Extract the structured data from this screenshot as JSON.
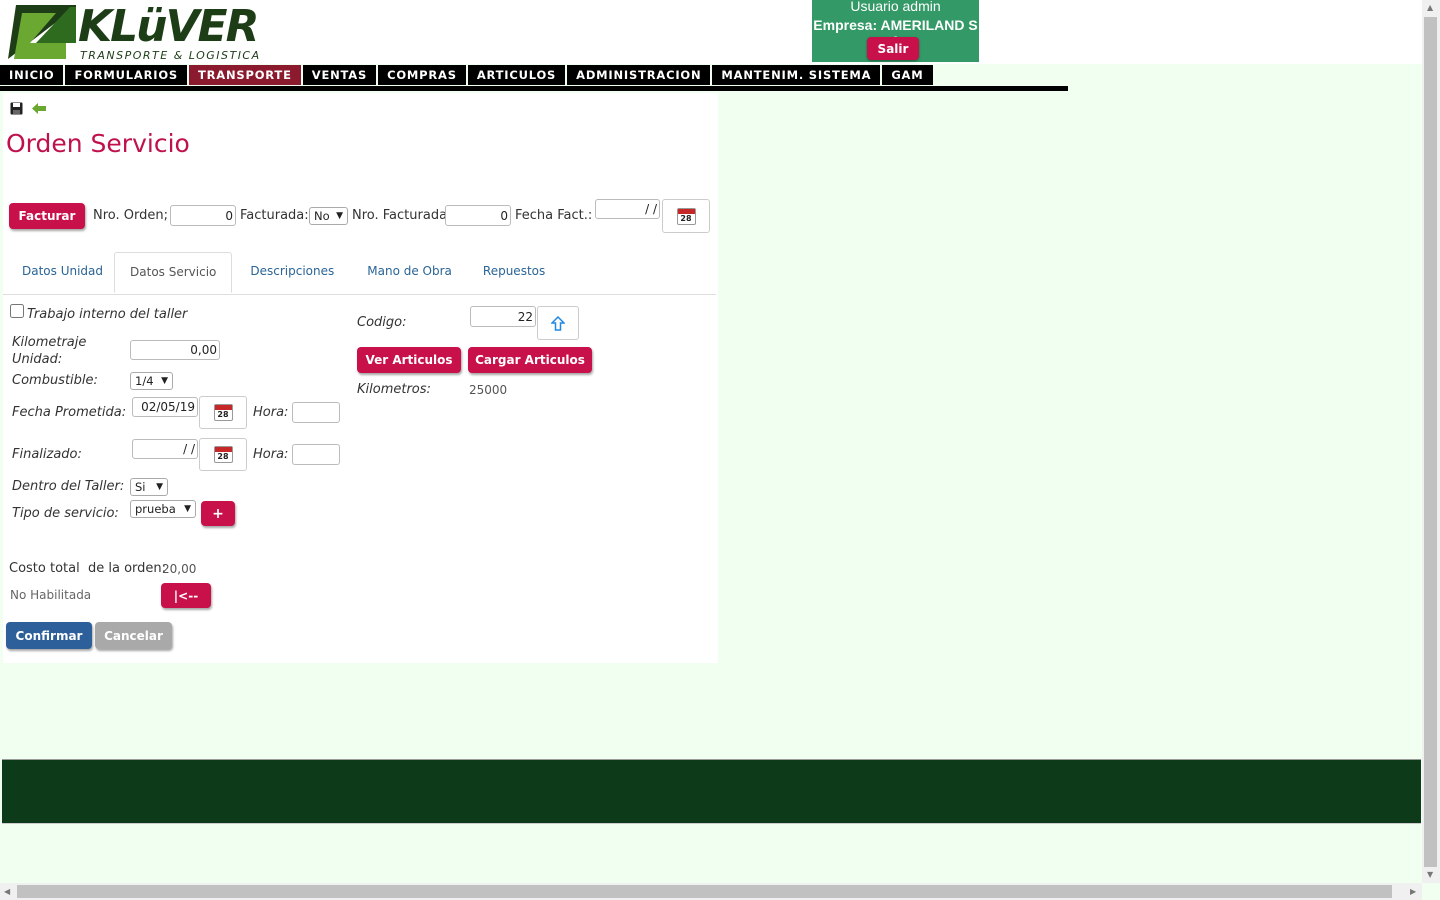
{
  "header": {
    "logo_text": "KLüVER",
    "logo_tagline": "TRANSPORTE & LOGISTICA",
    "user_line": "Usuario admin",
    "company_line": "Empresa: AMERILAND S A",
    "logout_label": "Salir"
  },
  "nav": {
    "items": [
      "INICIO",
      "FORMULARIOS",
      "TRANSPORTE",
      "VENTAS",
      "COMPRAS",
      "ARTICULOS",
      "ADMINISTRACION",
      "MANTENIM. SISTEMA",
      "GAM"
    ],
    "active": "TRANSPORTE"
  },
  "toolbar": {
    "save_icon": "floppy-disk",
    "back_icon": "green-arrow-left"
  },
  "page_title": "Orden Servicio",
  "top_form": {
    "invoice_button": "Facturar",
    "order_no_label": "Nro. Orden;",
    "order_no_value": "0",
    "invoiced_label": "Facturada:",
    "invoiced_value": "No",
    "invoiced_no_label": "Nro. Facturada",
    "invoiced_no_value": "0",
    "invoice_date_label": "Fecha Fact.:",
    "invoice_date_value": "/ /"
  },
  "tabs": [
    "Datos Unidad",
    "Datos Servicio",
    "Descripciones",
    "Mano de Obra",
    "Repuestos"
  ],
  "active_tab": "Datos Servicio",
  "service": {
    "internal_work_label": "Trabajo interno del taller",
    "internal_work_checked": false,
    "mileage_label_1": "Kilometraje",
    "mileage_label_2": "Unidad:",
    "mileage_value": "0,00",
    "fuel_label": "Combustible:",
    "fuel_value": "1/4",
    "promised_date_label": "Fecha Prometida:",
    "promised_date_value": "02/05/19",
    "hour_label": "Hora:",
    "promised_hour_value": "",
    "finished_label": "Finalizado:",
    "finished_value": "/ /",
    "finished_hour_value": "",
    "in_workshop_label": "Dentro del Taller:",
    "in_workshop_value": "Si",
    "service_type_label": "Tipo de servicio:",
    "service_type_value": "prueba",
    "add_label": "+",
    "code_label": "Codigo:",
    "code_value": "22",
    "view_items_label": "Ver Articulos",
    "load_items_label": "Cargar Articulos",
    "km_label": "Kilometros:",
    "km_value": "25000"
  },
  "totals": {
    "total_label": "Costo total  de la orden:",
    "total_value": "20,00",
    "status_text": "No Habilitada",
    "first_button": "|<--"
  },
  "actions": {
    "confirm": "Confirmar",
    "cancel": "Cancelar"
  },
  "colors": {
    "accent": "#c8104a",
    "nav": "#000000",
    "nav_active": "#8b1a2e",
    "user_box": "#339966",
    "confirm": "#2d5f9a",
    "footer": "#0d3b1a",
    "background": "#f0fff0"
  }
}
